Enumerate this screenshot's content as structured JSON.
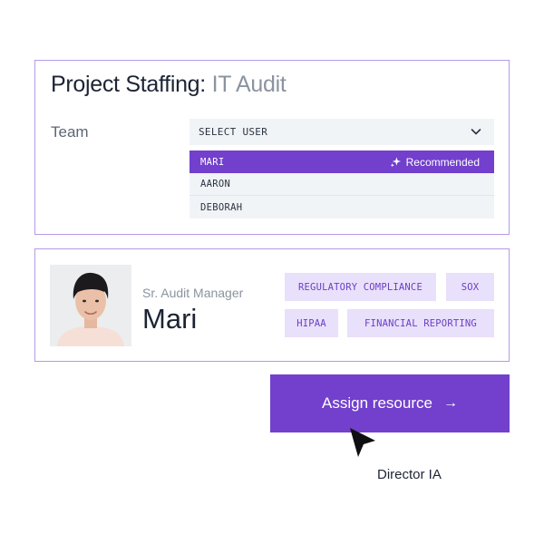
{
  "staffing": {
    "title_main": "Project Staffing:",
    "title_sub": "IT Audit",
    "team_label": "Team",
    "select_placeholder": "SELECT USER",
    "options": [
      {
        "label": "MARI",
        "recommended": true
      },
      {
        "label": "AARON"
      },
      {
        "label": "DEBORAH"
      }
    ],
    "recommended_label": "Recommended"
  },
  "profile": {
    "role": "Sr. Audit Manager",
    "name": "Mari",
    "tags": [
      "REGULATORY COMPLIANCE",
      "SOX",
      "HIPAA",
      "FINANCIAL REPORTING"
    ]
  },
  "action": {
    "assign_label": "Assign resource",
    "arrow_icon": "→"
  },
  "cursor": {
    "label": "Director IA"
  },
  "colors": {
    "accent": "#7240cc",
    "tag_bg": "#e9e0fb",
    "border": "#b59ae8"
  }
}
